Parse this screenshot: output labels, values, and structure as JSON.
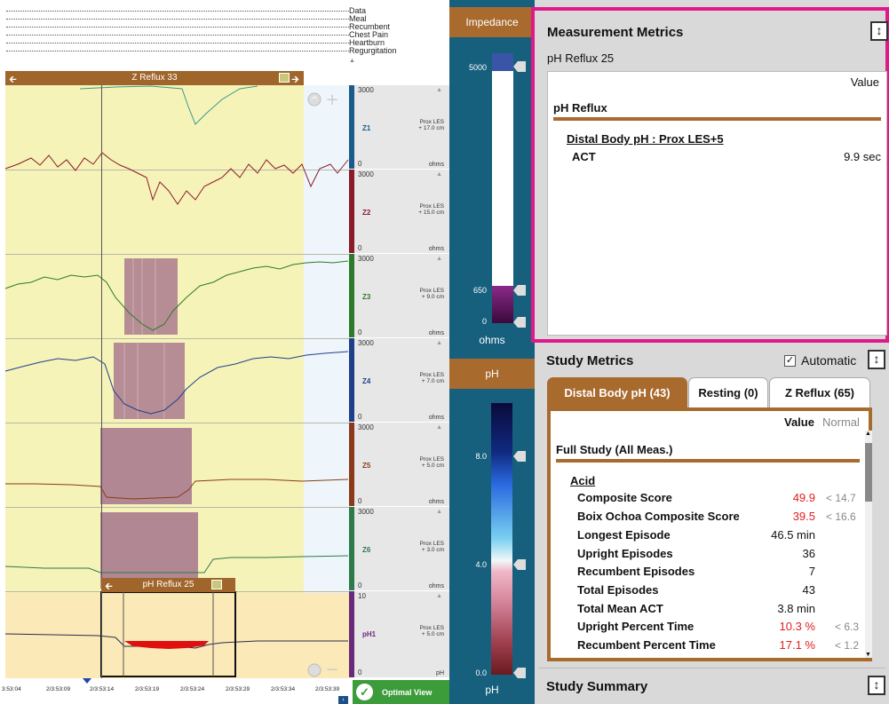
{
  "events": {
    "labels": [
      "Data",
      "Meal",
      "Recumbent",
      "Chest Pain",
      "Heartburn",
      "Regurgitation"
    ]
  },
  "zreflux_bar": {
    "title": "Z Reflux 33"
  },
  "phreflux_bar": {
    "title": "pH Reflux 25"
  },
  "channels": [
    {
      "name": "Z1",
      "loc1": "Prox LES",
      "loc2": "+ 17.0 cm",
      "max": "3000",
      "min": "0",
      "unit": "ohms",
      "color": "#1b5b8a"
    },
    {
      "name": "Z2",
      "loc1": "Prox LES",
      "loc2": "+ 15.0 cm",
      "max": "3000",
      "min": "0",
      "unit": "ohms",
      "color": "#8b1a2a"
    },
    {
      "name": "Z3",
      "loc1": "Prox LES",
      "loc2": "+ 9.0 cm",
      "max": "3000",
      "min": "0",
      "unit": "ohms",
      "color": "#2f7a2a"
    },
    {
      "name": "Z4",
      "loc1": "Prox LES",
      "loc2": "+ 7.0 cm",
      "max": "3000",
      "min": "0",
      "unit": "ohms",
      "color": "#1f3f8a"
    },
    {
      "name": "Z5",
      "loc1": "Prox LES",
      "loc2": "+ 5.0 cm",
      "max": "3000",
      "min": "0",
      "unit": "ohms",
      "color": "#8a3a1a"
    },
    {
      "name": "Z6",
      "loc1": "Prox LES",
      "loc2": "+ 3.0 cm",
      "max": "3000",
      "min": "0",
      "unit": "ohms",
      "color": "#2e7a4a"
    },
    {
      "name": "pH1",
      "loc1": "Prox LES",
      "loc2": "+ 5.0 cm",
      "max": "10",
      "min": "0",
      "unit": "pH",
      "color": "#6a2a7a"
    }
  ],
  "time_axis": {
    "ticks": [
      "3:53:04",
      "2/3:53:09",
      "2/3:53:14",
      "2/3:53:19",
      "2/3:53:24",
      "2/3:53:29",
      "2/3:53:34",
      "2/3:53:39"
    ]
  },
  "optimal_view": {
    "label": "Optimal View"
  },
  "impedance_gauge": {
    "title": "Impedance",
    "ticks": [
      "5000",
      "650",
      "0"
    ],
    "unit": "ohms"
  },
  "ph_gauge": {
    "title": "pH",
    "ticks": [
      "8.0",
      "4.0",
      "0.0"
    ],
    "unit": "pH"
  },
  "measurement_metrics": {
    "title": "Measurement Metrics",
    "subtitle": "pH Reflux 25",
    "value_header": "Value",
    "section": "pH Reflux",
    "subsection": "Distal Body pH : Prox LES+5",
    "row_label": "ACT",
    "row_value": "9.9 sec"
  },
  "study_metrics": {
    "title": "Study Metrics",
    "automatic_label": "Automatic",
    "automatic_checked": true,
    "tabs": [
      {
        "label": "Distal Body pH (43)",
        "active": true
      },
      {
        "label": "Resting (0)",
        "active": false
      },
      {
        "label": "Z Reflux (65)",
        "active": false
      }
    ],
    "value_header": "Value",
    "normal_header": "Normal",
    "section": "Full Study (All Meas.)",
    "subsection": "Acid",
    "rows": [
      {
        "label": "Composite Score",
        "value": "49.9",
        "normal": "< 14.7",
        "abnormal": true
      },
      {
        "label": "Boix Ochoa Composite Score",
        "value": "39.5",
        "normal": "< 16.6",
        "abnormal": true
      },
      {
        "label": "Longest Episode",
        "value": "46.5 min",
        "normal": "",
        "abnormal": false
      },
      {
        "label": "Upright Episodes",
        "value": "36",
        "normal": "",
        "abnormal": false
      },
      {
        "label": "Recumbent Episodes",
        "value": "7",
        "normal": "",
        "abnormal": false
      },
      {
        "label": "Total Episodes",
        "value": "43",
        "normal": "",
        "abnormal": false
      },
      {
        "label": "Total Mean ACT",
        "value": "3.8 min",
        "normal": "",
        "abnormal": false
      },
      {
        "label": "Upright Percent Time",
        "value": "10.3 %",
        "normal": "< 6.3",
        "abnormal": true
      },
      {
        "label": "Recumbent Percent Time",
        "value": "17.1 %",
        "normal": "< 1.2",
        "abnormal": true
      }
    ]
  },
  "study_summary": {
    "title": "Study Summary"
  },
  "colors": {
    "accent_brown": "#a96a2e",
    "highlight_magenta": "#e0198a",
    "abnormal_red": "#e02020",
    "gauge_bg": "#165f7d"
  }
}
